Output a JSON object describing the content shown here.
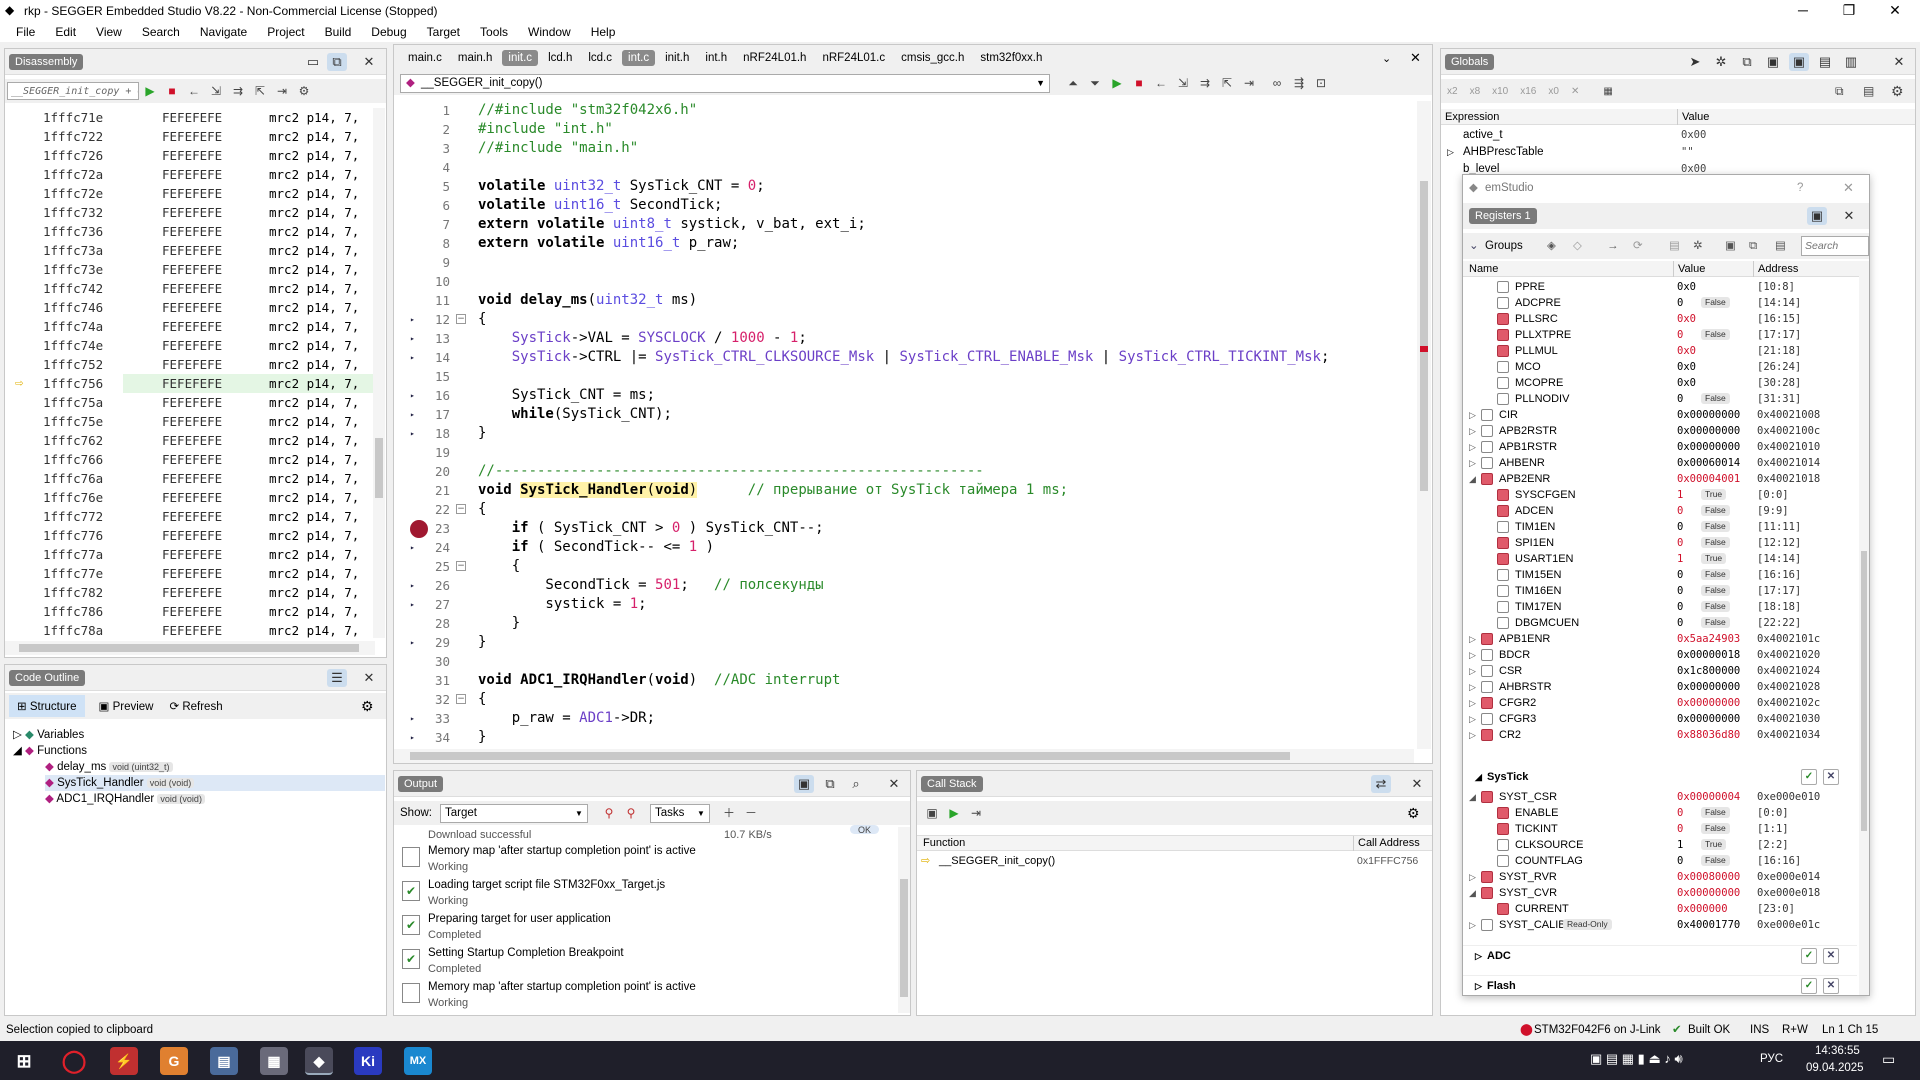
{
  "window": {
    "title": "rkp - SEGGER Embedded Studio V8.22 - Non-Commercial License (Stopped)"
  },
  "menu": [
    "File",
    "Edit",
    "View",
    "Search",
    "Navigate",
    "Project",
    "Build",
    "Debug",
    "Target",
    "Tools",
    "Window",
    "Help"
  ],
  "disassembly": {
    "tab": "Disassembly",
    "location": "__SEGGER_init_copy + 0x",
    "rows": [
      {
        "addr": "1fffc71e",
        "bytes": "FEFEFEFE",
        "instr": "mrc2 p14, 7,"
      },
      {
        "addr": "1fffc722",
        "bytes": "FEFEFEFE",
        "instr": "mrc2 p14, 7,"
      },
      {
        "addr": "1fffc726",
        "bytes": "FEFEFEFE",
        "instr": "mrc2 p14, 7,"
      },
      {
        "addr": "1fffc72a",
        "bytes": "FEFEFEFE",
        "instr": "mrc2 p14, 7,"
      },
      {
        "addr": "1fffc72e",
        "bytes": "FEFEFEFE",
        "instr": "mrc2 p14, 7,"
      },
      {
        "addr": "1fffc732",
        "bytes": "FEFEFEFE",
        "instr": "mrc2 p14, 7,"
      },
      {
        "addr": "1fffc736",
        "bytes": "FEFEFEFE",
        "instr": "mrc2 p14, 7,"
      },
      {
        "addr": "1fffc73a",
        "bytes": "FEFEFEFE",
        "instr": "mrc2 p14, 7,"
      },
      {
        "addr": "1fffc73e",
        "bytes": "FEFEFEFE",
        "instr": "mrc2 p14, 7,"
      },
      {
        "addr": "1fffc742",
        "bytes": "FEFEFEFE",
        "instr": "mrc2 p14, 7,"
      },
      {
        "addr": "1fffc746",
        "bytes": "FEFEFEFE",
        "instr": "mrc2 p14, 7,"
      },
      {
        "addr": "1fffc74a",
        "bytes": "FEFEFEFE",
        "instr": "mrc2 p14, 7,"
      },
      {
        "addr": "1fffc74e",
        "bytes": "FEFEFEFE",
        "instr": "mrc2 p14, 7,"
      },
      {
        "addr": "1fffc752",
        "bytes": "FEFEFEFE",
        "instr": "mrc2 p14, 7,"
      },
      {
        "addr": "1fffc756",
        "bytes": "FEFEFEFE",
        "instr": "mrc2 p14, 7,"
      },
      {
        "addr": "1fffc75a",
        "bytes": "FEFEFEFE",
        "instr": "mrc2 p14, 7,"
      },
      {
        "addr": "1fffc75e",
        "bytes": "FEFEFEFE",
        "instr": "mrc2 p14, 7,"
      },
      {
        "addr": "1fffc762",
        "bytes": "FEFEFEFE",
        "instr": "mrc2 p14, 7,"
      },
      {
        "addr": "1fffc766",
        "bytes": "FEFEFEFE",
        "instr": "mrc2 p14, 7,"
      },
      {
        "addr": "1fffc76a",
        "bytes": "FEFEFEFE",
        "instr": "mrc2 p14, 7,"
      },
      {
        "addr": "1fffc76e",
        "bytes": "FEFEFEFE",
        "instr": "mrc2 p14, 7,"
      },
      {
        "addr": "1fffc772",
        "bytes": "FEFEFEFE",
        "instr": "mrc2 p14, 7,"
      },
      {
        "addr": "1fffc776",
        "bytes": "FEFEFEFE",
        "instr": "mrc2 p14, 7,"
      },
      {
        "addr": "1fffc77a",
        "bytes": "FEFEFEFE",
        "instr": "mrc2 p14, 7,"
      },
      {
        "addr": "1fffc77e",
        "bytes": "FEFEFEFE",
        "instr": "mrc2 p14, 7,"
      },
      {
        "addr": "1fffc782",
        "bytes": "FEFEFEFE",
        "instr": "mrc2 p14, 7,"
      },
      {
        "addr": "1fffc786",
        "bytes": "FEFEFEFE",
        "instr": "mrc2 p14, 7,"
      },
      {
        "addr": "1fffc78a",
        "bytes": "FEFEFEFE",
        "instr": "mrc2 p14, 7,"
      }
    ],
    "current_addr": "1fffc756"
  },
  "outline": {
    "tab": "Code Outline",
    "structure": "Structure",
    "preview": "Preview",
    "refresh": "Refresh",
    "variables": "Variables",
    "functions": "Functions",
    "items": [
      {
        "name": "delay_ms",
        "sig": "void (uint32_t)"
      },
      {
        "name": "SysTick_Handler",
        "sig": "void (void)"
      },
      {
        "name": "ADC1_IRQHandler",
        "sig": "void (void)"
      }
    ]
  },
  "editor": {
    "tabs": [
      "main.c",
      "main.h",
      "init.c",
      "lcd.h",
      "lcd.c",
      "int.c",
      "init.h",
      "int.h",
      "nRF24L01.h",
      "nRF24L01.c",
      "cmsis_gcc.h",
      "stm32f0xx.h"
    ],
    "active_tabs": [
      "init.c",
      "int.c"
    ],
    "function_selector": "__SEGGER_init_copy()",
    "lines": [
      {
        "n": "1",
        "h": "<span class='cm'>//#include \"stm32f042x6.h\"</span>"
      },
      {
        "n": "2",
        "h": "<span class='cm'>#include \"int.h\"</span>"
      },
      {
        "n": "3",
        "h": "<span class='cm'>//#include \"main.h\"</span>"
      },
      {
        "n": "4",
        "h": ""
      },
      {
        "n": "5",
        "h": "<span class='kw'>volatile</span> <span class='ty'>uint32_t</span> SysTick_CNT = <span class='nu'>0</span>;"
      },
      {
        "n": "6",
        "h": "<span class='kw'>volatile</span> <span class='ty'>uint16_t</span> SecondTick;"
      },
      {
        "n": "7",
        "h": "<span class='kw'>extern volatile</span> <span class='ty'>uint8_t</span> systick, v_bat, ext_i;"
      },
      {
        "n": "8",
        "h": "<span class='kw'>extern volatile</span> <span class='ty'>uint16_t</span> p_raw;"
      },
      {
        "n": "9",
        "h": ""
      },
      {
        "n": "10",
        "h": ""
      },
      {
        "n": "11",
        "h": "<span class='kw'>void delay_ms</span>(<span class='ty'>uint32_t</span> ms)"
      },
      {
        "n": "12",
        "h": "{"
      },
      {
        "n": "13",
        "h": "    <span class='fn'>SysTick</span>-&gt;VAL = <span class='fn'>SYSCLOCK</span> / <span class='nu'>1000</span> - <span class='nu'>1</span>;"
      },
      {
        "n": "14",
        "h": "    <span class='fn'>SysTick</span>-&gt;CTRL |= <span class='fn'>SysTick_CTRL_CLKSOURCE_Msk</span> | <span class='fn'>SysTick_CTRL_ENABLE_Msk</span> | <span class='fn'>SysTick_CTRL_TICKINT_Msk</span>;"
      },
      {
        "n": "15",
        "h": ""
      },
      {
        "n": "16",
        "h": "    SysTick_CNT = ms;"
      },
      {
        "n": "17",
        "h": "    <span class='kw'>while</span>(SysTick_CNT);"
      },
      {
        "n": "18",
        "h": "}"
      },
      {
        "n": "19",
        "h": ""
      },
      {
        "n": "20",
        "h": "<span class='cm'>//----------------------------------------------------------</span>"
      },
      {
        "n": "21",
        "h": "<span class='kw'>void</span> <span class='kw hl'>SysTick_Handler</span><span class='hl'>(<span class='kw'>void</span>)</span>      <span class='cm'>// прерывание от SysTick таймера 1 ms;</span>"
      },
      {
        "n": "22",
        "h": "{"
      },
      {
        "n": "23",
        "h": "    <span class='kw'>if</span> ( SysTick_CNT &gt; <span class='nu'>0</span> ) SysTick_CNT--;"
      },
      {
        "n": "24",
        "h": "    <span class='kw'>if</span> ( SecondTick-- &lt;= <span class='nu'>1</span> )"
      },
      {
        "n": "25",
        "h": "    {"
      },
      {
        "n": "26",
        "h": "        SecondTick = <span class='nu'>501</span>;   <span class='cm'>// полсекунды</span>"
      },
      {
        "n": "27",
        "h": "        systick = <span class='nu'>1</span>;"
      },
      {
        "n": "28",
        "h": "    }"
      },
      {
        "n": "29",
        "h": "}"
      },
      {
        "n": "30",
        "h": ""
      },
      {
        "n": "31",
        "h": "<span class='kw'>void ADC1_IRQHandler</span>(<span class='kw'>void</span>)  <span class='cm'>//ADC interrupt</span>"
      },
      {
        "n": "32",
        "h": "{"
      },
      {
        "n": "33",
        "h": "    p_raw = <span class='fn'>ADC1</span>-&gt;DR;"
      },
      {
        "n": "34",
        "h": "}"
      }
    ]
  },
  "output": {
    "tab": "Output",
    "show_label": "Show:",
    "show_value": "Target",
    "tasks": "Tasks",
    "partial": "Download successful",
    "partial_rate": "10.7 KB/s",
    "partial_badge": "OK",
    "items": [
      {
        "t": "Memory map 'after startup completion point' is active",
        "s": "Working"
      },
      {
        "t": "Loading target script file STM32F0xx_Target.js",
        "s": "Working"
      },
      {
        "t": "Preparing target for user application",
        "s": "Completed"
      },
      {
        "t": "Setting Startup Completion Breakpoint",
        "s": "Completed"
      },
      {
        "t": "Memory map 'after startup completion point' is active",
        "s": "Working"
      }
    ]
  },
  "callstack": {
    "tab": "Call Stack",
    "col_function": "Function",
    "col_addr": "Call Address",
    "row_fn": "__SEGGER_init_copy()",
    "row_addr": "0x1FFFC756"
  },
  "globals": {
    "tab": "Globals",
    "col_expr": "Expression",
    "col_value": "Value",
    "rows": [
      {
        "e": "active_t",
        "v": "0x00"
      },
      {
        "e": "AHBPrescTable",
        "v": "\"\""
      },
      {
        "e": "b_level",
        "v": "0x00"
      }
    ],
    "fmt": [
      "x2",
      "x8",
      "x10",
      "x16",
      "x0"
    ]
  },
  "emstudio": {
    "title": "emStudio",
    "help": "?",
    "tab": "Registers 1",
    "groups": "Groups",
    "search": "Search",
    "col_name": "Name",
    "col_value": "Value",
    "col_addr": "Address",
    "rows": [
      {
        "lv": 2,
        "n": "PPRE",
        "v": "0x0",
        "a": "[10:8]",
        "red": false
      },
      {
        "lv": 2,
        "n": "ADCPRE",
        "v": "0",
        "b": "False",
        "a": "[14:14]",
        "red": false
      },
      {
        "lv": 2,
        "n": "PLLSRC",
        "v": "0x0",
        "a": "[16:15]",
        "red": true
      },
      {
        "lv": 2,
        "n": "PLLXTPRE",
        "v": "0",
        "b": "False",
        "a": "[17:17]",
        "red": true
      },
      {
        "lv": 2,
        "n": "PLLMUL",
        "v": "0x0",
        "a": "[21:18]",
        "red": true
      },
      {
        "lv": 2,
        "n": "MCO",
        "v": "0x0",
        "a": "[26:24]",
        "red": false
      },
      {
        "lv": 2,
        "n": "MCOPRE",
        "v": "0x0",
        "a": "[30:28]",
        "red": false
      },
      {
        "lv": 2,
        "n": "PLLNODIV",
        "v": "0",
        "b": "False",
        "a": "[31:31]",
        "red": false
      },
      {
        "lv": 1,
        "ex": "▷",
        "n": "CIR",
        "v": "0x00000000",
        "a": "0x40021008",
        "red": false
      },
      {
        "lv": 1,
        "ex": "▷",
        "n": "APB2RSTR",
        "v": "0x00000000",
        "a": "0x4002100c",
        "red": false
      },
      {
        "lv": 1,
        "ex": "▷",
        "n": "APB1RSTR",
        "v": "0x00000000",
        "a": "0x40021010",
        "red": false
      },
      {
        "lv": 1,
        "ex": "▷",
        "n": "AHBENR",
        "v": "0x00060014",
        "a": "0x40021014",
        "red": false
      },
      {
        "lv": 1,
        "ex": "◢",
        "n": "APB2ENR",
        "v": "0x00004001",
        "a": "0x40021018",
        "red": true
      },
      {
        "lv": 2,
        "n": "SYSCFGEN",
        "v": "1",
        "b": "True",
        "a": "[0:0]",
        "red": true
      },
      {
        "lv": 2,
        "n": "ADCEN",
        "v": "0",
        "b": "False",
        "a": "[9:9]",
        "red": true
      },
      {
        "lv": 2,
        "n": "TIM1EN",
        "v": "0",
        "b": "False",
        "a": "[11:11]",
        "red": false
      },
      {
        "lv": 2,
        "n": "SPI1EN",
        "v": "0",
        "b": "False",
        "a": "[12:12]",
        "red": true
      },
      {
        "lv": 2,
        "n": "USART1EN",
        "v": "1",
        "b": "True",
        "a": "[14:14]",
        "red": true
      },
      {
        "lv": 2,
        "n": "TIM15EN",
        "v": "0",
        "b": "False",
        "a": "[16:16]",
        "red": false
      },
      {
        "lv": 2,
        "n": "TIM16EN",
        "v": "0",
        "b": "False",
        "a": "[17:17]",
        "red": false
      },
      {
        "lv": 2,
        "n": "TIM17EN",
        "v": "0",
        "b": "False",
        "a": "[18:18]",
        "red": false
      },
      {
        "lv": 2,
        "n": "DBGMCUEN",
        "v": "0",
        "b": "False",
        "a": "[22:22]",
        "red": false
      },
      {
        "lv": 1,
        "ex": "▷",
        "n": "APB1ENR",
        "v": "0x5aa24903",
        "a": "0x4002101c",
        "red": true
      },
      {
        "lv": 1,
        "ex": "▷",
        "n": "BDCR",
        "v": "0x00000018",
        "a": "0x40021020",
        "red": false
      },
      {
        "lv": 1,
        "ex": "▷",
        "n": "CSR",
        "v": "0x1c800000",
        "a": "0x40021024",
        "red": false
      },
      {
        "lv": 1,
        "ex": "▷",
        "n": "AHBRSTR",
        "v": "0x00000000",
        "a": "0x40021028",
        "red": false
      },
      {
        "lv": 1,
        "ex": "▷",
        "n": "CFGR2",
        "v": "0x00000000",
        "a": "0x4002102c",
        "red": true
      },
      {
        "lv": 1,
        "ex": "▷",
        "n": "CFGR3",
        "v": "0x00000000",
        "a": "0x40021030",
        "red": false
      },
      {
        "lv": 1,
        "ex": "▷",
        "n": "CR2",
        "v": "0x88036d80",
        "a": "0x40021034",
        "red": true
      }
    ],
    "systick_group": "SysTick",
    "systick_rows": [
      {
        "lv": 1,
        "ex": "◢",
        "n": "SYST_CSR",
        "v": "0x00000004",
        "a": "0xe000e010",
        "red": true
      },
      {
        "lv": 2,
        "n": "ENABLE",
        "v": "0",
        "b": "False",
        "a": "[0:0]",
        "red": true
      },
      {
        "lv": 2,
        "n": "TICKINT",
        "v": "0",
        "b": "False",
        "a": "[1:1]",
        "red": true
      },
      {
        "lv": 2,
        "n": "CLKSOURCE",
        "v": "1",
        "b": "True",
        "a": "[2:2]",
        "red": false
      },
      {
        "lv": 2,
        "n": "COUNTFLAG",
        "v": "0",
        "b": "False",
        "a": "[16:16]",
        "red": false
      },
      {
        "lv": 1,
        "ex": "▷",
        "n": "SYST_RVR",
        "v": "0x00080000",
        "a": "0xe000e014",
        "red": true
      },
      {
        "lv": 1,
        "ex": "◢",
        "n": "SYST_CVR",
        "v": "0x00000000",
        "a": "0xe000e018",
        "red": true
      },
      {
        "lv": 2,
        "n": "CURRENT",
        "v": "0x000000",
        "a": "[23:0]",
        "red": true
      },
      {
        "lv": 1,
        "ex": "▷",
        "n": "SYST_CALIB",
        "ro": "Read-Only",
        "v": "0x40001770",
        "a": "0xe000e01c",
        "red": false
      }
    ],
    "adc_group": "ADC",
    "flash_group": "Flash"
  },
  "status": {
    "left": "Selection copied to clipboard",
    "target": "STM32F042F6 on J-Link",
    "build": "Built OK",
    "ins": "INS",
    "rw": "R+W",
    "pos": "Ln 1 Ch 15"
  },
  "taskbar": {
    "lang": "РУС",
    "time": "14:36:55",
    "date": "09.04.2025"
  }
}
